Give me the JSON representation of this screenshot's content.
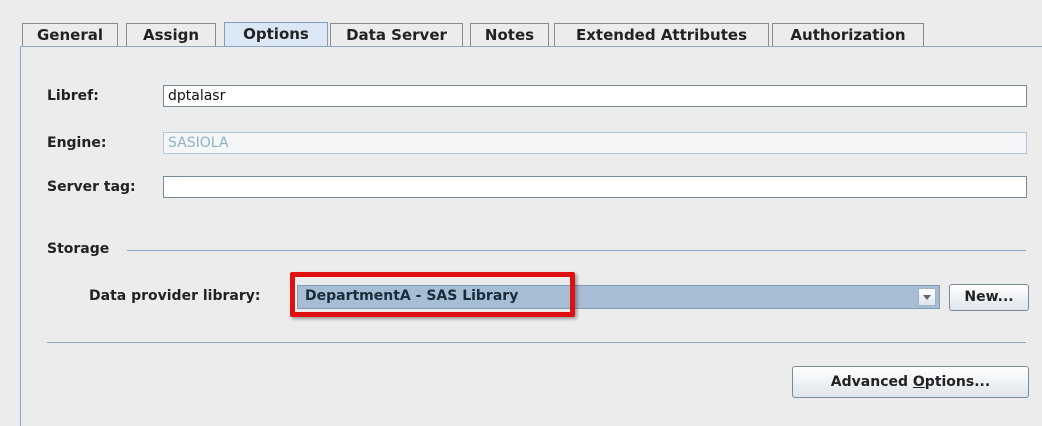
{
  "tabs": [
    {
      "label": "General",
      "active": false
    },
    {
      "label": "Assign",
      "active": false
    },
    {
      "label": "Options",
      "active": true
    },
    {
      "label": "Data Server",
      "active": false
    },
    {
      "label": "Notes",
      "active": false
    },
    {
      "label": "Extended Attributes",
      "active": false
    },
    {
      "label": "Authorization",
      "active": false
    }
  ],
  "form": {
    "libref_label": "Libref:",
    "libref_value": "dptalasr",
    "engine_label": "Engine:",
    "engine_value": "SASIOLA",
    "server_tag_label": "Server tag:",
    "server_tag_value": ""
  },
  "storage": {
    "group_label": "Storage",
    "provider_label": "Data provider library:",
    "provider_value": "DepartmentA - SAS Library",
    "new_button": "New..."
  },
  "advanced": {
    "label_before": "Advanced ",
    "mnemonic": "O",
    "label_after": "ptions..."
  },
  "colors": {
    "highlight": "#e01010",
    "selection": "#a6bdd4",
    "active_tab": "#dbe7f4"
  }
}
